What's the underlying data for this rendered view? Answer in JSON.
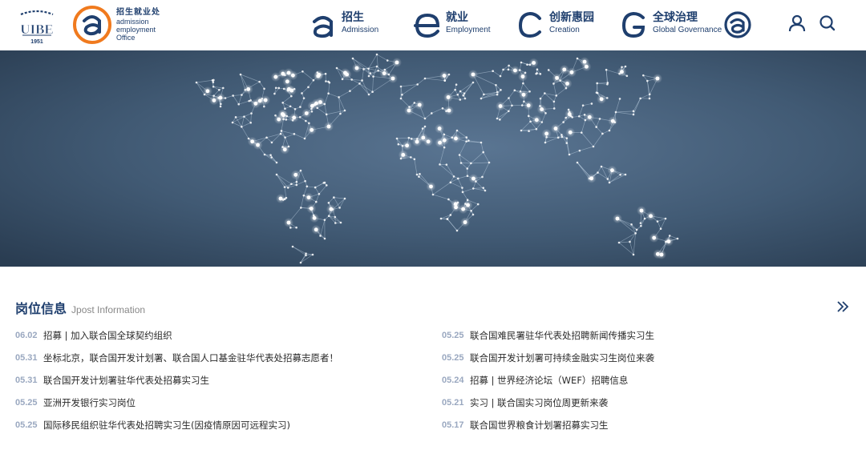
{
  "header": {
    "university_year": "1951",
    "office_cn": "招生就业处",
    "office_en_1": "admission",
    "office_en_2": "employment",
    "office_en_3": "Office",
    "nav": [
      {
        "cn": "招生",
        "en": "Admission",
        "icon": "a-letter-icon"
      },
      {
        "cn": "就业",
        "en": "Employment",
        "icon": "e-letter-icon"
      },
      {
        "cn": "创新惠园",
        "en": "Creation",
        "icon": "c-letter-icon"
      },
      {
        "cn": "全球治理",
        "en": "Global Governance",
        "icon": "g-letter-icon"
      }
    ]
  },
  "colors": {
    "brand_navy": "#1f3f6e",
    "brand_orange": "#f07a1e",
    "date_gray": "#9aa8c0",
    "banner_bg": "#3b5169"
  },
  "jobs": {
    "title_cn": "岗位信息",
    "title_en": "Jpost Information",
    "left": [
      {
        "date": "06.02",
        "title": "招募 | 加入联合国全球契约组织"
      },
      {
        "date": "05.31",
        "title": "坐标北京，联合国开发计划署、联合国人口基金驻华代表处招募志愿者！"
      },
      {
        "date": "05.31",
        "title": "联合国开发计划署驻华代表处招募实习生"
      },
      {
        "date": "05.25",
        "title": "亚洲开发银行实习岗位"
      },
      {
        "date": "05.25",
        "title": "国际移民组织驻华代表处招聘实习生(因疫情原因可远程实习)"
      }
    ],
    "right": [
      {
        "date": "05.25",
        "title": "联合国难民署驻华代表处招聘新闻传播实习生"
      },
      {
        "date": "05.25",
        "title": "联合国开发计划署可持续金融实习生岗位来袭"
      },
      {
        "date": "05.24",
        "title": "招募 | 世界经济论坛（WEF）招聘信息"
      },
      {
        "date": "05.21",
        "title": "实习 | 联合国实习岗位周更新来袭"
      },
      {
        "date": "05.17",
        "title": "联合国世界粮食计划署招募实习生"
      }
    ]
  }
}
